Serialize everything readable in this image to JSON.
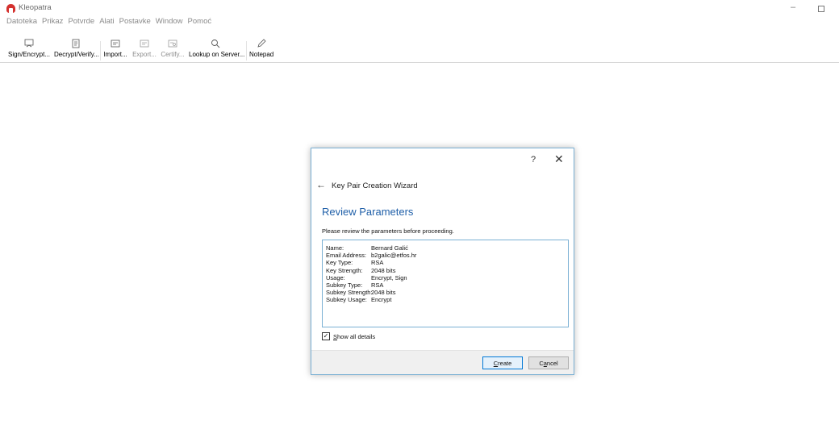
{
  "window": {
    "title": "Kleopatra",
    "minimize_glyph": "–"
  },
  "menu": [
    "Datoteka",
    "Prikaz",
    "Potvrde",
    "Alati",
    "Postavke",
    "Window",
    "Pomoć"
  ],
  "toolbar": {
    "sign_encrypt": "Sign/Encrypt...",
    "decrypt_verify": "Decrypt/Verify...",
    "import": "Import...",
    "export": "Export...",
    "certify": "Certify...",
    "lookup": "Lookup on Server...",
    "notepad": "Notepad"
  },
  "dialog": {
    "help": "?",
    "close": "✕",
    "back": "←",
    "wizard_title": "Key Pair Creation Wizard",
    "heading": "Review Parameters",
    "description": "Please review the parameters before proceeding.",
    "params": [
      {
        "key": "Name:",
        "value": "Bernard Galić"
      },
      {
        "key": "Email Address:",
        "value": "b2galic@etfos.hr"
      },
      {
        "key": "Key Type:",
        "value": "RSA"
      },
      {
        "key": "Key Strength:",
        "value": "2048 bits"
      },
      {
        "key": "Usage:",
        "value": "Encrypt, Sign"
      },
      {
        "key": "Subkey Type:",
        "value": "RSA"
      },
      {
        "key": "Subkey Strength:",
        "value": "2048 bits"
      },
      {
        "key": "Subkey Usage:",
        "value": "Encrypt"
      }
    ],
    "show_all_details": {
      "first": "S",
      "rest": "how all details",
      "checked": true
    },
    "create": {
      "first": "C",
      "rest": "reate"
    },
    "cancel": {
      "first": "C",
      "mid": "a",
      "rest": "ncel"
    }
  },
  "colors": {
    "accent": "#1f5fa8",
    "dialog_border": "#7ab0d4",
    "app_icon": "#d4322f"
  }
}
